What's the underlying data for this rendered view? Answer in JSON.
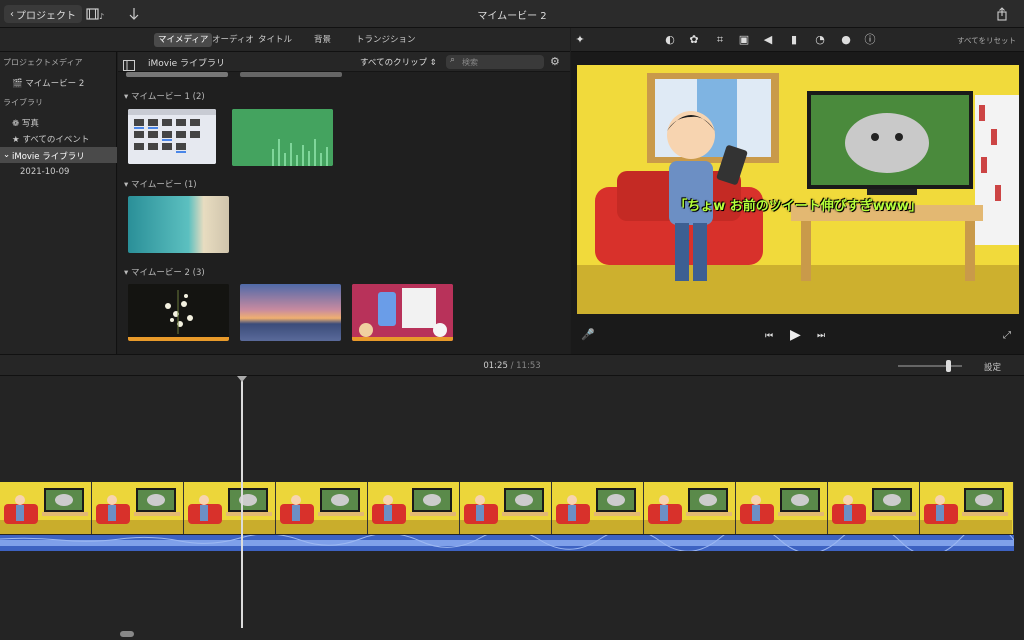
{
  "toolbar": {
    "back_label": "プロジェクト",
    "title": "マイムービー 2"
  },
  "tabs": [
    "マイメディア",
    "オーディオ",
    "タイトル",
    "背景",
    "トランジション"
  ],
  "viewer_tools": {
    "reset_label": "すべてをリセット",
    "icons": [
      "magic-wand-icon",
      "color-balance-icon",
      "color-palette-icon",
      "crop-icon",
      "stabilization-icon",
      "volume-icon",
      "equalizer-icon",
      "speed-icon",
      "filter-icon",
      "info-icon"
    ]
  },
  "sidebar": {
    "project_media_header": "プロジェクトメディア",
    "project_item": "マイムービー 2",
    "library_header": "ライブラリ",
    "photos": "写真",
    "all_events": "すべてのイベント",
    "imovie_library": "iMovie ライブラリ",
    "date_event": "2021-10-09"
  },
  "browser": {
    "library_title": "iMovie ライブラリ",
    "clip_filter": "すべてのクリップ",
    "search_placeholder": "検索",
    "groups": [
      {
        "label": "マイムービー 1",
        "count": "(2)"
      },
      {
        "label": "マイムービー",
        "count": "(1)"
      },
      {
        "label": "マイムービー 2",
        "count": "(3)"
      }
    ]
  },
  "viewer": {
    "caption": "「ちょw お前のツイート伸びすぎwww」"
  },
  "timeline": {
    "current_time": "01:25",
    "separator": "/",
    "total_time": "11:53",
    "settings_label": "設定"
  },
  "colors": {
    "accent": "#4a90d9",
    "audio_wave": "#3d62c2",
    "video_bg": "#f3dc3a",
    "caption_text": "#b6ff3a"
  }
}
